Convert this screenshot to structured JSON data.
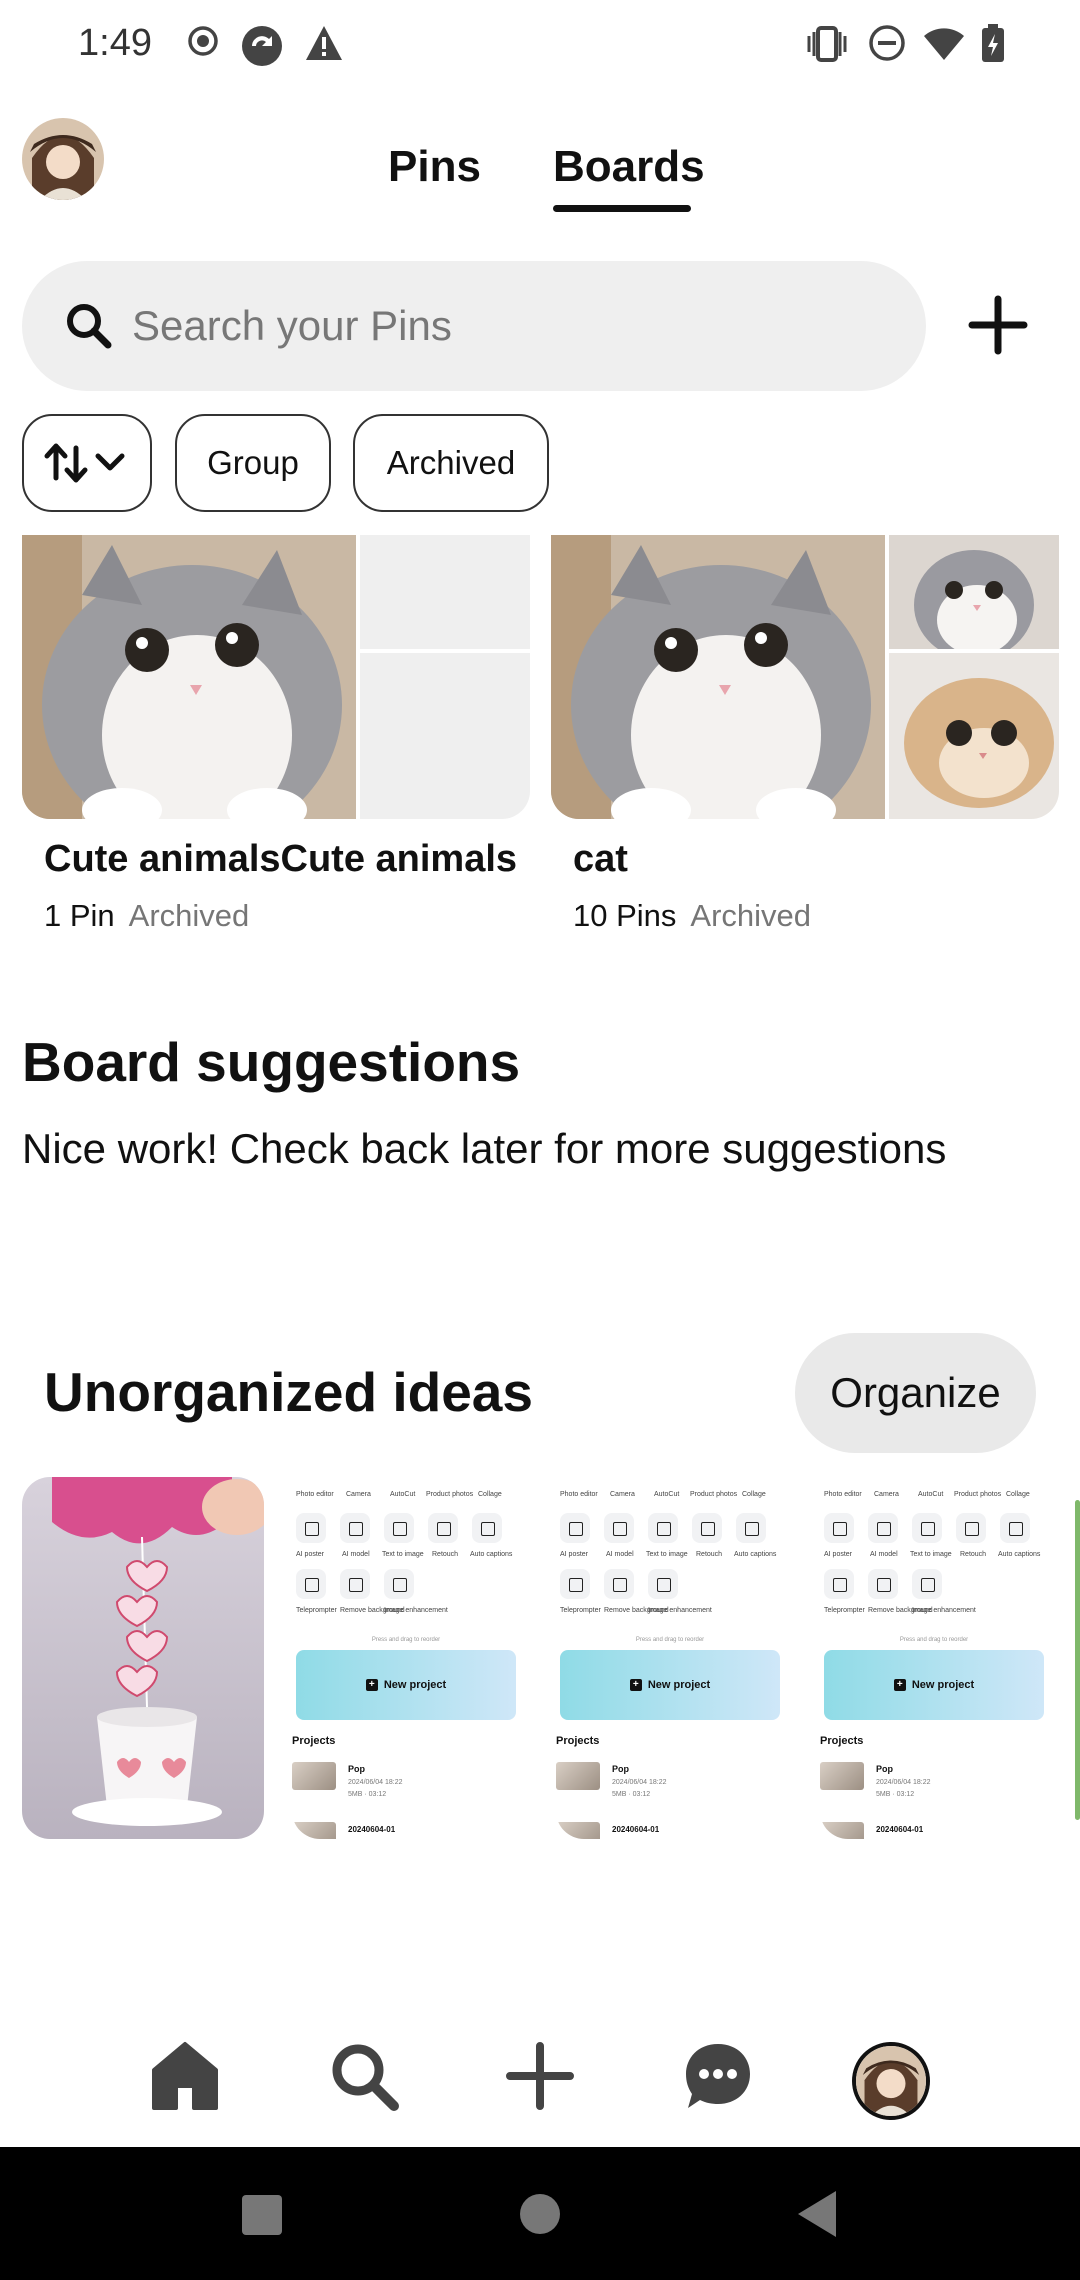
{
  "status_bar": {
    "time": "1:49"
  },
  "header": {
    "tabs": [
      {
        "label": "Pins",
        "selected": false
      },
      {
        "label": "Boards",
        "selected": true
      }
    ]
  },
  "search": {
    "placeholder": "Search your Pins",
    "value": ""
  },
  "filters": {
    "sort_icon": "sort-arrows-icon",
    "chips": [
      "Group",
      "Archived"
    ]
  },
  "boards": [
    {
      "title": "Cute animalsCute animals",
      "pin_count": "1 Pin",
      "status": "Archived"
    },
    {
      "title": "cat",
      "pin_count": "10 Pins",
      "status": "Archived"
    }
  ],
  "suggestions": {
    "title": "Board suggestions",
    "message": "Nice work! Check back later for more suggestions"
  },
  "unorganized": {
    "title": "Unorganized ideas",
    "organize_label": "Organize",
    "screenshot_labels": {
      "tools_row1": [
        "Photo editor",
        "Camera",
        "AutoCut",
        "Product photos",
        "Collage"
      ],
      "tools_row2": [
        "AI poster",
        "AI model",
        "Text to image",
        "Retouch",
        "Auto captions"
      ],
      "tools_row3": [
        "Teleprompter",
        "Remove background",
        "Image enhancement"
      ],
      "hint": "Press and drag to reorder",
      "new_project": "New project",
      "projects": "Projects",
      "project_name": "Pop",
      "project_date": "2024/06/04 18:22",
      "project_size": "5MB · 03:12",
      "project_next": "20240604-01"
    }
  },
  "bottom_nav": [
    "home-icon",
    "search-icon",
    "create-icon",
    "messages-icon",
    "profile-avatar"
  ],
  "colors": {
    "text": "#111111",
    "muted": "#767676",
    "search_bg": "#efefef",
    "organize_bg": "#e9e9e9"
  }
}
